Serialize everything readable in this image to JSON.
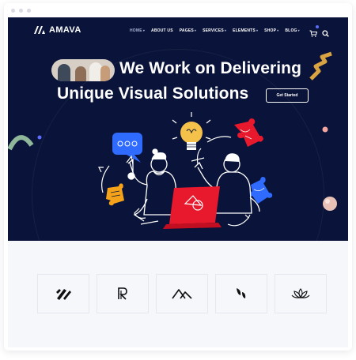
{
  "header": {
    "logo_text": "AMAVA",
    "nav": [
      {
        "label": "HOME",
        "has_dropdown": true,
        "active": true
      },
      {
        "label": "ABOUT US",
        "has_dropdown": false,
        "active": false
      },
      {
        "label": "PAGES",
        "has_dropdown": true,
        "active": false
      },
      {
        "label": "SERVICES",
        "has_dropdown": true,
        "active": false
      },
      {
        "label": "ELEMENTS",
        "has_dropdown": true,
        "active": false
      },
      {
        "label": "SHOP",
        "has_dropdown": true,
        "active": false
      },
      {
        "label": "BLOG",
        "has_dropdown": true,
        "active": false
      }
    ],
    "icons": [
      "cart-icon",
      "search-icon"
    ]
  },
  "hero": {
    "title_line1": "We Work on Delivering",
    "title_line2": "Unique Visual Solutions",
    "cta_label": "Get Started"
  },
  "brands": [
    {
      "icon": "slashes-logo-icon"
    },
    {
      "icon": "r-monogram-logo-icon"
    },
    {
      "icon": "mountains-logo-icon"
    },
    {
      "icon": "leaf-shapes-logo-icon"
    },
    {
      "icon": "lotus-logo-icon"
    }
  ],
  "colors": {
    "hero_background": "#0a1339",
    "accent_red": "#e8192c",
    "accent_blue": "#2f6bff",
    "accent_yellow": "#f4c14a",
    "brands_background": "#f6f7fb"
  }
}
